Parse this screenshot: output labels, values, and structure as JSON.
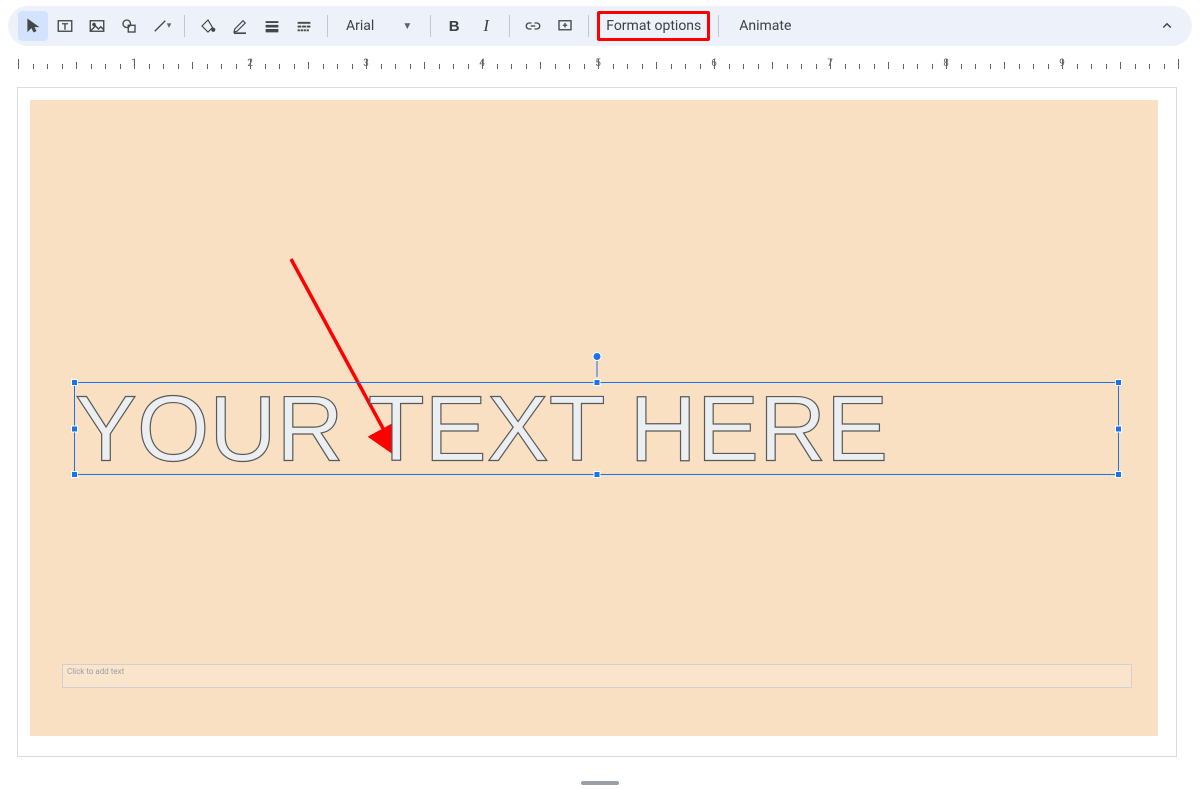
{
  "toolbar": {
    "font_name": "Arial",
    "format_options_label": "Format options",
    "animate_label": "Animate"
  },
  "ruler": {
    "labels": [
      "1",
      "2",
      "3",
      "4",
      "5",
      "6",
      "7",
      "8",
      "9"
    ]
  },
  "slide": {
    "wordart_text": "YOUR TEXT HERE",
    "subtitle_placeholder": "Click to add text"
  }
}
